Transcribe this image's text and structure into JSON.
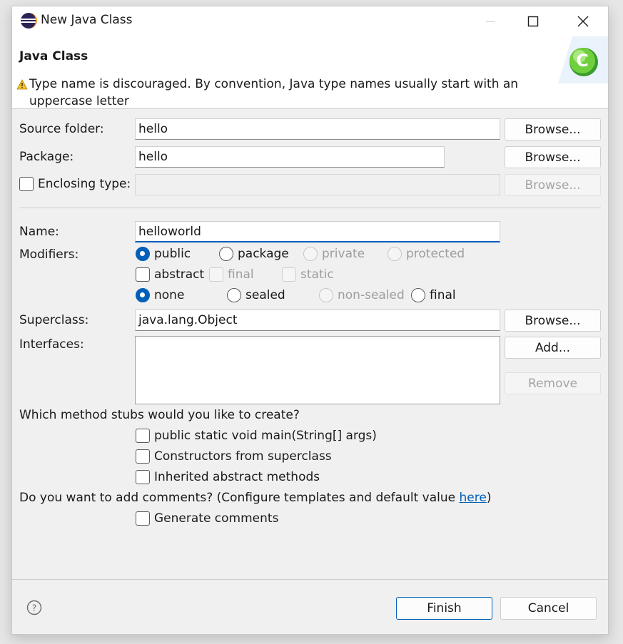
{
  "window": {
    "title": "New Java Class"
  },
  "header": {
    "title": "Java Class",
    "warning": "Type name is discouraged. By convention, Java type names usually start with an uppercase letter"
  },
  "form": {
    "source_folder": {
      "label": "Source folder:",
      "value": "hello",
      "browse": "Browse..."
    },
    "package": {
      "label": "Package:",
      "value": "hello",
      "browse": "Browse..."
    },
    "enclosing_type": {
      "label": "Enclosing type:",
      "value": "",
      "browse": "Browse..."
    },
    "name": {
      "label": "Name:",
      "value": "helloworld"
    },
    "modifiers": {
      "label": "Modifiers:",
      "visibility": [
        "public",
        "package",
        "private",
        "protected"
      ],
      "selected_visibility": "public",
      "checks": [
        "abstract",
        "final",
        "static"
      ],
      "sealing": [
        "none",
        "sealed",
        "non-sealed",
        "final"
      ],
      "selected_sealing": "none"
    },
    "superclass": {
      "label": "Superclass:",
      "value": "java.lang.Object",
      "browse": "Browse..."
    },
    "interfaces": {
      "label": "Interfaces:",
      "add": "Add...",
      "remove": "Remove"
    },
    "stubs": {
      "question": "Which method stubs would you like to create?",
      "options": [
        "public static void main(String[] args)",
        "Constructors from superclass",
        "Inherited abstract methods"
      ]
    },
    "comments": {
      "question": "Do you want to add comments? (Configure templates and default value ",
      "link": "here",
      "suffix": ")",
      "option": "Generate comments"
    }
  },
  "footer": {
    "finish": "Finish",
    "cancel": "Cancel"
  },
  "colors": {
    "accent": "#005fb8",
    "warning": "#f2c12e"
  },
  "icons": [
    "eclipse-icon",
    "minimize-icon",
    "maximize-icon",
    "close-icon",
    "warning-icon",
    "java-class-icon",
    "help-icon"
  ]
}
